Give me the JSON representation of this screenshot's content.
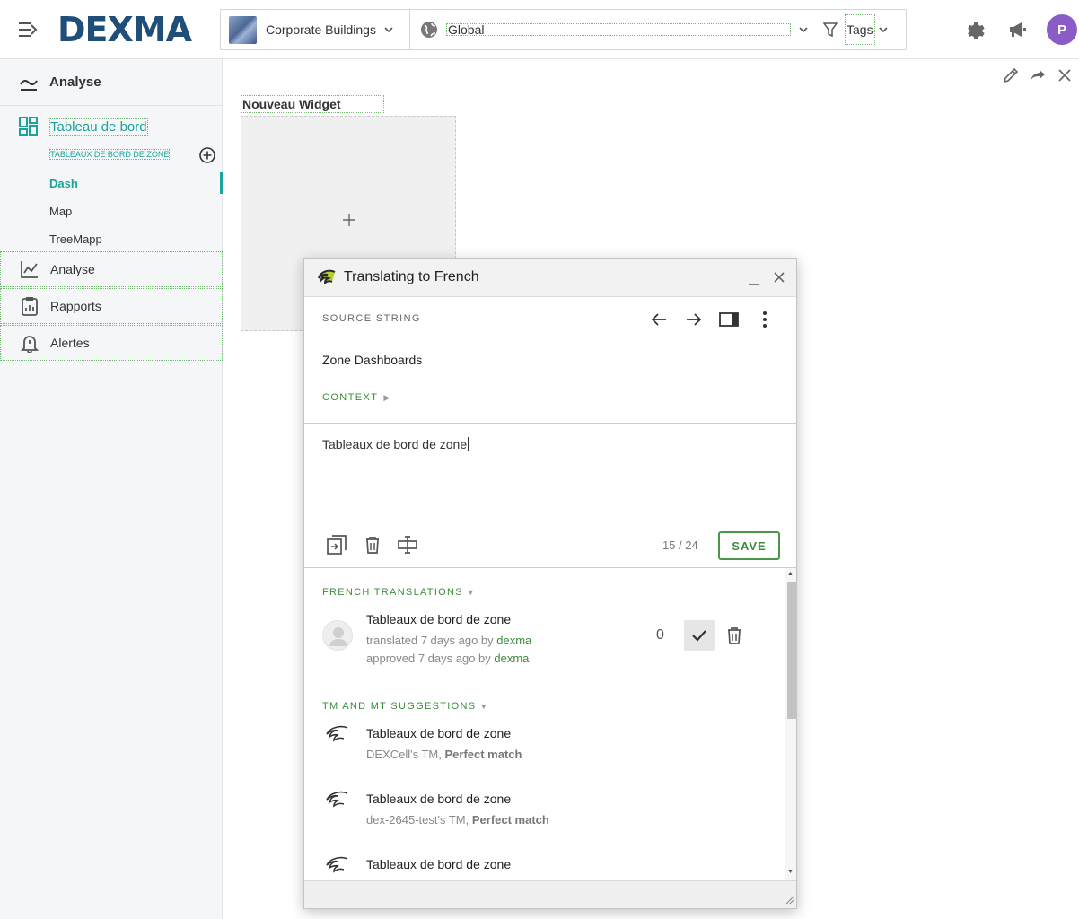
{
  "header": {
    "logo_text": "DEXMA",
    "location_selector": "Corporate Buildings",
    "scope_selector": "Global",
    "tags_label": "Tags",
    "avatar_initial": "P"
  },
  "sidebar": {
    "section_title": "Analyse",
    "dashboard_title": "Tableau de bord",
    "zone_dashboards_label": "TABLEAUX DE BORD DE ZONE",
    "sub_items": [
      "Dash",
      "Map",
      "TreeMapp"
    ],
    "items": [
      {
        "label": "Analyse",
        "icon": "chart-line-icon"
      },
      {
        "label": "Rapports",
        "icon": "clipboard-icon"
      },
      {
        "label": "Alertes",
        "icon": "bell-icon"
      }
    ]
  },
  "main": {
    "widget_title": "Nouveau Widget",
    "widget_add_symbol": "+"
  },
  "dialog": {
    "title": "Translating to French",
    "source_label": "SOURCE STRING",
    "source_string": "Zone Dashboards",
    "context_label": "CONTEXT",
    "context_arrow": "▶",
    "translation_value": "Tableaux de bord de zone",
    "char_count": "15 / 24",
    "save_label": "SAVE",
    "translations_section": "FRENCH TRANSLATIONS",
    "section_arrow": "▼",
    "existing_translation": {
      "text": "Tableaux de bord de zone",
      "translated_prefix": "translated 7 days ago by ",
      "translated_user": "dexma",
      "approved_prefix": "approved 7 days ago by ",
      "approved_user": "dexma",
      "votes": "0"
    },
    "suggestions_section": "TM AND MT SUGGESTIONS",
    "suggestions": [
      {
        "text": "Tableaux de bord de zone",
        "source": "DEXCell's TM, ",
        "match": "Perfect match"
      },
      {
        "text": "Tableaux de bord de zone",
        "source": "dex-2645-test's TM, ",
        "match": "Perfect match"
      },
      {
        "text": "Tableaux de bord de zone",
        "source": "",
        "match": ""
      }
    ]
  },
  "colors": {
    "teal_accent": "#1aa39a",
    "green_accent": "#3c8c3c",
    "logo_blue": "#1f4e79",
    "avatar_purple": "#8a5cc6"
  }
}
